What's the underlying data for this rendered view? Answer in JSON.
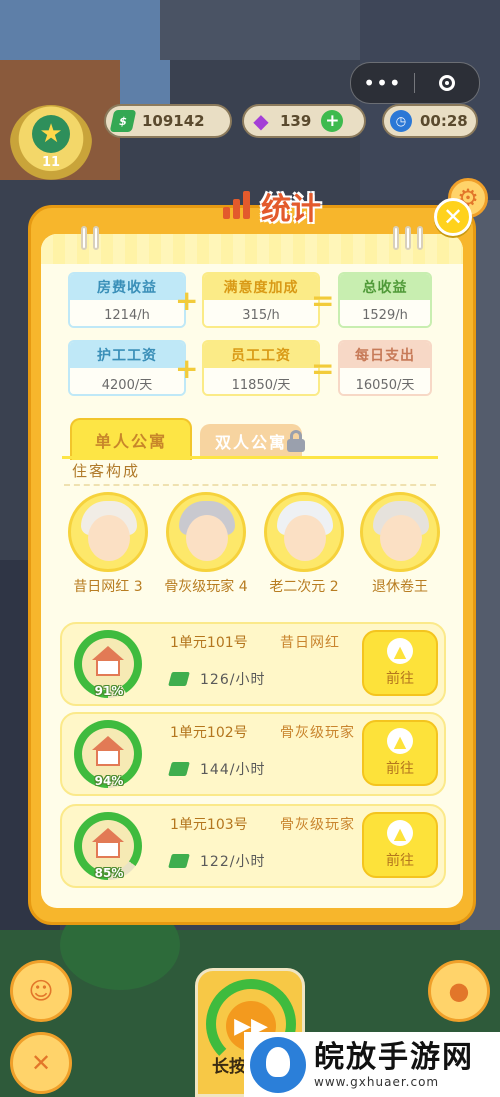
{
  "hud": {
    "level": "11",
    "cash": "109142",
    "gems": "139",
    "timer": "00:28"
  },
  "window_controls": {
    "more": "•••"
  },
  "modal": {
    "title": "统计",
    "close": "✕"
  },
  "stats": {
    "row1": [
      {
        "label": "房费收益",
        "value": "1214/h",
        "color": "#3a8fb8"
      },
      {
        "label": "满意度加成",
        "value": "315/h",
        "color": "#d99a16"
      },
      {
        "label": "总收益",
        "value": "1529/h",
        "color": "#4f9a38"
      }
    ],
    "row2": [
      {
        "label": "护工工资",
        "value": "4200/天",
        "color": "#3a8fb8"
      },
      {
        "label": "员工工资",
        "value": "11850/天",
        "color": "#d99a16"
      },
      {
        "label": "每日支出",
        "value": "16050/天",
        "color": "#c77a58"
      }
    ],
    "plus": "+",
    "equals": "="
  },
  "tabs": {
    "single": "单人公寓",
    "double": "双人公寓"
  },
  "section": {
    "residents_label": "住客构成"
  },
  "residents": [
    {
      "name": "昔日网红 3"
    },
    {
      "name": "骨灰级玩家 4"
    },
    {
      "name": "老二次元 2"
    },
    {
      "name": "退休卷王"
    }
  ],
  "apartments": [
    {
      "room": "1单元101号",
      "tenant": "昔日网红",
      "income": "126/小时",
      "percent": "91%",
      "progress": 0.91,
      "go": "前往"
    },
    {
      "room": "1单元102号",
      "tenant": "骨灰级玩家",
      "income": "144/小时",
      "percent": "94%",
      "progress": 0.94,
      "go": "前往"
    },
    {
      "room": "1单元103号",
      "tenant": "骨灰级玩家",
      "income": "122/小时",
      "percent": "85%",
      "progress": 0.85,
      "go": "前往"
    }
  ],
  "bottom": {
    "hold_label": "长按加"
  },
  "watermark": {
    "title": "皖放手游网",
    "url": "www.gxhuaer.com"
  },
  "colors": {
    "modal_frame": "#f7b62c",
    "accent_red": "#e35a2c",
    "progress_green": "#3fbb3e"
  }
}
